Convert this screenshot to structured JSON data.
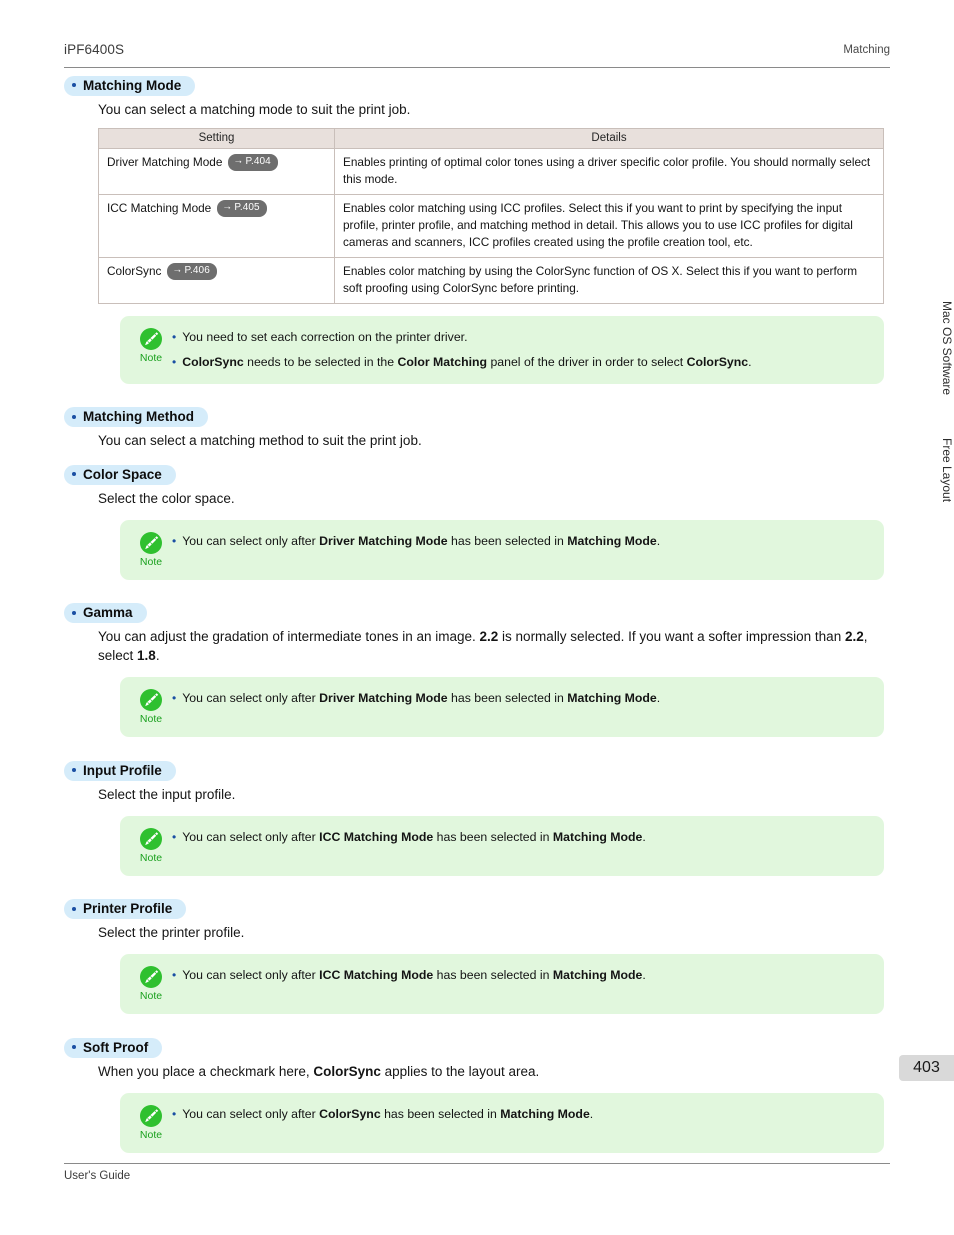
{
  "header": {
    "product": "iPF6400S",
    "section": "Matching"
  },
  "sections": {
    "matching_mode": {
      "heading": "Matching Mode",
      "body": "You can select a matching mode to suit the print job."
    },
    "matching_method": {
      "heading": "Matching Method",
      "body": "You can select a matching method to suit the print job."
    },
    "color_space": {
      "heading": "Color Space",
      "body": "Select the color space."
    },
    "gamma": {
      "heading": "Gamma",
      "body_1": "You can adjust the gradation of intermediate tones in an image. ",
      "body_b1": "2.2",
      "body_2": " is normally selected. If you want a softer impression than ",
      "body_b2": "2.2",
      "body_3": ", select ",
      "body_b3": "1.8",
      "body_4": "."
    },
    "input_profile": {
      "heading": "Input Profile",
      "body": "Select the input profile."
    },
    "printer_profile": {
      "heading": "Printer Profile",
      "body": "Select the printer profile."
    },
    "soft_proof": {
      "heading": "Soft Proof",
      "body_1": "When you place a checkmark here, ",
      "body_b1": "ColorSync",
      "body_2": " applies to the layout area."
    }
  },
  "table": {
    "columns": [
      "Setting",
      "Details"
    ],
    "rows": [
      {
        "setting": "Driver Matching Mode",
        "ref_arrow": "→",
        "ref": "P.404",
        "details": "Enables printing of optimal color tones using a driver specific color profile. You should normally select this mode."
      },
      {
        "setting": "ICC Matching Mode",
        "ref_arrow": "→",
        "ref": "P.405",
        "details": "Enables color matching using ICC profiles. Select this if you want to print by specifying the input profile, printer profile, and matching method in detail. This allows you to use ICC profiles for digital cameras and scanners, ICC profiles created using the profile creation tool, etc."
      },
      {
        "setting": "ColorSync",
        "ref_arrow": "→",
        "ref": "P.406",
        "details": "Enables color matching by using the ColorSync function of OS X. Select this if you want to perform soft proofing using ColorSync before printing."
      }
    ]
  },
  "notes": {
    "label": "Note",
    "bullet": "•",
    "matching_mode": {
      "item1": "You need to set each correction on the printer driver.",
      "item2_1": "",
      "item2_b1": "ColorSync",
      "item2_2": " needs to be selected in the ",
      "item2_b2": "Color Matching",
      "item2_3": " panel of the driver in order to select ",
      "item2_b3": "ColorSync",
      "item2_4": "."
    },
    "color_space": {
      "t1": "You can select only after ",
      "b1": "Driver Matching Mode",
      "t2": " has been selected in ",
      "b2": "Matching Mode",
      "t3": "."
    },
    "gamma": {
      "t1": "You can select only after ",
      "b1": "Driver Matching Mode",
      "t2": " has been selected in ",
      "b2": "Matching Mode",
      "t3": "."
    },
    "input_profile": {
      "t1": "You can select only after ",
      "b1": "ICC Matching Mode",
      "t2": " has been selected in ",
      "b2": "Matching Mode",
      "t3": "."
    },
    "printer_profile": {
      "t1": "You can select only after ",
      "b1": "ICC Matching Mode",
      "t2": " has been selected in ",
      "b2": "Matching Mode",
      "t3": "."
    },
    "soft_proof": {
      "t1": "You can select only after ",
      "b1": "ColorSync",
      "t2": " has been selected in ",
      "b2": "Matching Mode",
      "t3": "."
    }
  },
  "side_tabs": {
    "tab1": "Mac OS Software",
    "tab2": "Free Layout"
  },
  "page_number": "403",
  "footer": "User's Guide",
  "colors": {
    "heading_pill": "#d5ecfa",
    "note_bg": "#e1f7dd",
    "note_green": "#19a01d",
    "table_header": "#e8e0dc",
    "ref_pill": "#6e6e6e",
    "tab_highlight": "#cdf0f0"
  }
}
